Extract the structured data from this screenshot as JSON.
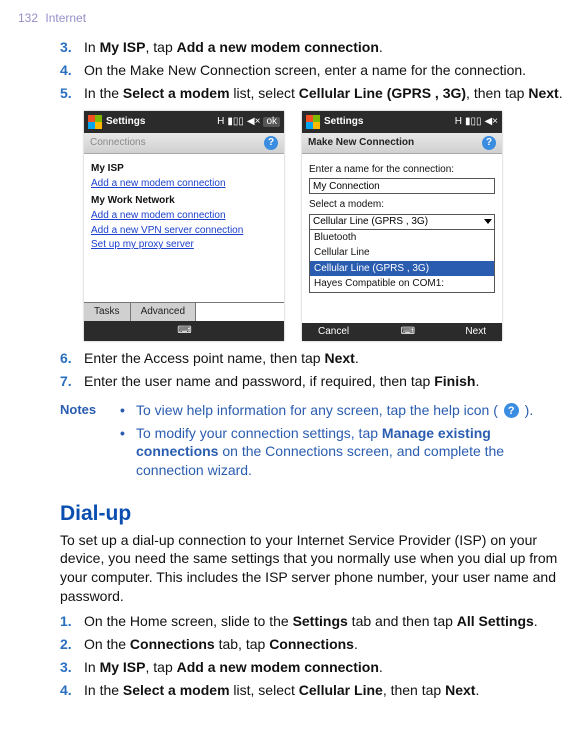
{
  "header": {
    "page_number": "132",
    "chapter": "Internet"
  },
  "steps_a": [
    {
      "num": "3.",
      "before": "In ",
      "b1": "My ISP",
      "mid": ", tap ",
      "b2": "Add a new modem connection",
      "after": "."
    },
    {
      "num": "4.",
      "text": "On the Make New Connection screen, enter a name for the connection."
    },
    {
      "num": "5.",
      "before": "In the ",
      "b1": "Select a modem",
      "mid": " list, select ",
      "b2": "Cellular Line (GPRS , 3G)",
      "after": ", then tap ",
      "b3": "Next",
      "tail": "."
    }
  ],
  "phone_left": {
    "title": "Settings",
    "crumb": "Connections",
    "sec1": "My ISP",
    "link1": "Add a new modem connection",
    "sec2": "My Work Network",
    "link2": "Add a new modem connection",
    "link3": "Add a new VPN server connection",
    "link4": "Set up my proxy server",
    "tab1": "Tasks",
    "tab2": "Advanced"
  },
  "phone_right": {
    "title": "Settings",
    "crumb": "Make New Connection",
    "label1": "Enter a name for the connection:",
    "inputval": "My Connection",
    "label2": "Select a modem:",
    "selected": "Cellular Line (GPRS , 3G)",
    "opt1": "Bluetooth",
    "opt2": "Cellular Line",
    "opt3": "Cellular Line (GPRS , 3G)",
    "opt4": "Hayes Compatible on COM1:",
    "cancel": "Cancel",
    "next": "Next"
  },
  "steps_b": [
    {
      "num": "6.",
      "before": "Enter the Access point name, then tap ",
      "b1": "Next",
      "after": "."
    },
    {
      "num": "7.",
      "before": "Enter the user name and password, if required, then tap ",
      "b1": "Finish",
      "after": "."
    }
  ],
  "notes": {
    "label": "Notes",
    "n1_before": "To view help information for any screen, tap the help icon (",
    "n1_after": ").",
    "n2_before": "To modify your connection settings, tap ",
    "n2_b": "Manage existing connections",
    "n2_after": " on the Connections screen, and complete the connection wizard."
  },
  "dialup": {
    "title": "Dial-up",
    "intro": "To set up a dial-up connection to your Internet Service Provider (ISP) on your device, you need the same settings that you normally use when you dial up from your computer. This includes the ISP server phone number, your user name and password.",
    "steps": [
      {
        "num": "1.",
        "before": "On the Home screen, slide to the ",
        "b1": "Settings",
        "mid": " tab and then tap ",
        "b2": "All Settings",
        "after": "."
      },
      {
        "num": "2.",
        "before": "On the ",
        "b1": "Connections",
        "mid": " tab, tap ",
        "b2": "Connections",
        "after": "."
      },
      {
        "num": "3.",
        "before": "In ",
        "b1": "My ISP",
        "mid": ", tap ",
        "b2": "Add a new modem connection",
        "after": "."
      },
      {
        "num": "4.",
        "before": "In the ",
        "b1": "Select a modem",
        "mid": " list, select ",
        "b2": "Cellular Line",
        "after": ", then tap ",
        "b3": "Next",
        "tail": "."
      }
    ]
  }
}
